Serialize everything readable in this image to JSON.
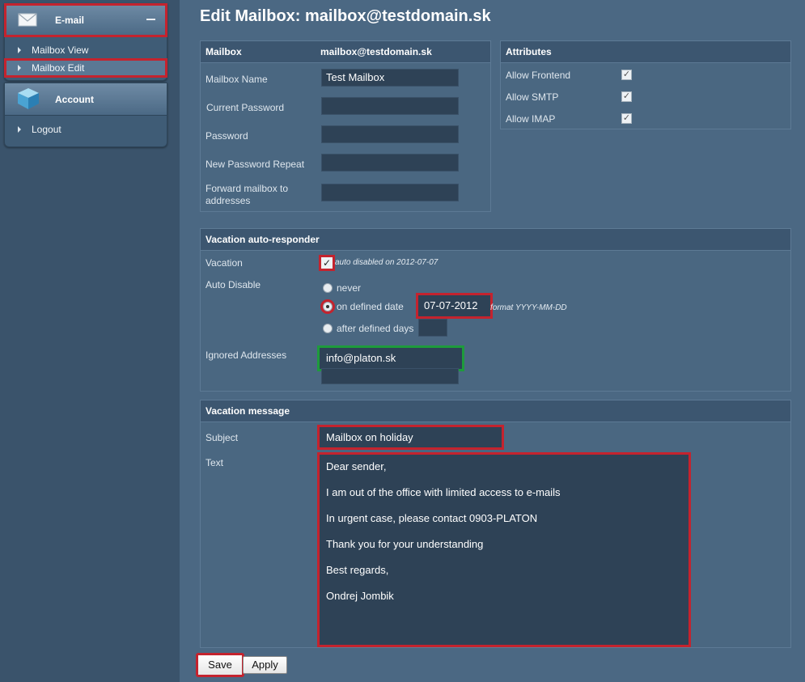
{
  "sidebar": {
    "email_section": {
      "title": "E-mail",
      "icon": "envelope-icon"
    },
    "email_items": [
      {
        "label": "Mailbox View"
      },
      {
        "label": "Mailbox Edit"
      }
    ],
    "account_section": {
      "title": "Account",
      "icon": "cube-icon"
    },
    "account_items": [
      {
        "label": "Logout"
      }
    ]
  },
  "page": {
    "title": "Edit Mailbox: mailbox@testdomain.sk"
  },
  "mailbox": {
    "header_label": "Mailbox",
    "header_value": "mailbox@testdomain.sk",
    "name_label": "Mailbox Name",
    "name_value": "Test Mailbox",
    "current_password_label": "Current Password",
    "password_label": "Password",
    "new_password_repeat_label": "New Password Repeat",
    "forward_label": "Forward mailbox to addresses"
  },
  "attributes": {
    "header": "Attributes",
    "items": [
      {
        "label": "Allow Frontend",
        "checked": true
      },
      {
        "label": "Allow SMTP",
        "checked": true
      },
      {
        "label": "Allow IMAP",
        "checked": true
      }
    ]
  },
  "vacation": {
    "header": "Vacation auto-responder",
    "vacation_label": "Vacation",
    "vacation_checked": true,
    "vacation_note": "auto disabled on 2012-07-07",
    "auto_disable_label": "Auto Disable",
    "option_never": "never",
    "option_defined_date": "on defined date",
    "option_defined_days": "after defined days",
    "selected_option": "on defined date",
    "date_value": "07-07-2012",
    "date_format_note": "format YYYY-MM-DD",
    "ignored_label": "Ignored Addresses",
    "ignored_value_1": "info@platon.sk",
    "ignored_value_2": ""
  },
  "message": {
    "header": "Vacation message",
    "subject_label": "Subject",
    "subject_value": "Mailbox on holiday",
    "text_label": "Text",
    "text_lines": [
      "Dear sender,",
      "I am out of the office with limited access to e-mails",
      "In urgent case, please contact 0903-PLATON",
      "Thank you for your understanding",
      "Best regards,",
      "Ondrej Jombik"
    ]
  },
  "buttons": {
    "save": "Save",
    "apply": "Apply"
  },
  "colors": {
    "highlight_red": "#c4232e",
    "highlight_green": "#1e9b3c"
  }
}
